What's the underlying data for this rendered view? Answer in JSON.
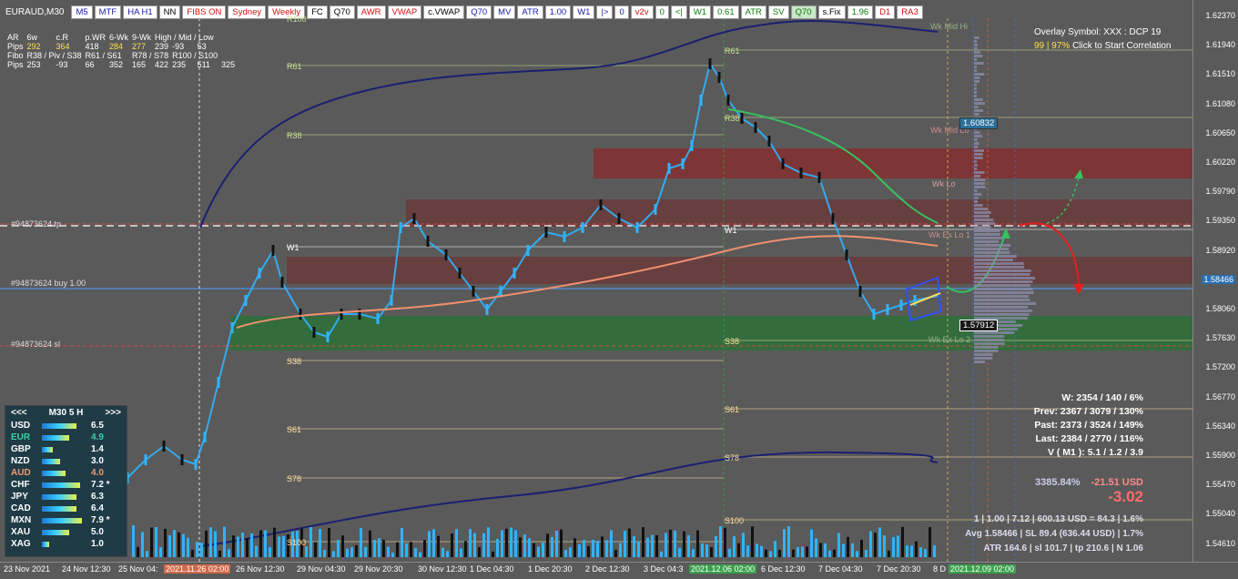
{
  "symbol": "EURAUD,M30",
  "toolbar": [
    {
      "label": "M5",
      "cls": ""
    },
    {
      "label": "MTF",
      "cls": ""
    },
    {
      "label": "HA H1",
      "cls": ""
    },
    {
      "label": "NN",
      "cls": "blk"
    },
    {
      "label": "FIBS ON",
      "cls": "red"
    },
    {
      "label": "Sydney",
      "cls": "red"
    },
    {
      "label": "Weekly",
      "cls": "red"
    },
    {
      "label": "FC",
      "cls": "blk"
    },
    {
      "label": "Q70",
      "cls": "blk"
    },
    {
      "label": "AWR",
      "cls": "red"
    },
    {
      "label": "VWAP",
      "cls": "red"
    },
    {
      "label": "c.VWAP",
      "cls": "blk"
    },
    {
      "label": "Q70",
      "cls": ""
    },
    {
      "label": "MV",
      "cls": ""
    },
    {
      "label": "ATR",
      "cls": ""
    },
    {
      "label": "1.00",
      "cls": ""
    },
    {
      "label": "W1",
      "cls": ""
    },
    {
      "label": "|>",
      "cls": ""
    },
    {
      "label": "0",
      "cls": ""
    },
    {
      "label": "v2v",
      "cls": "red"
    },
    {
      "label": "0",
      "cls": "grn"
    },
    {
      "label": "<|",
      "cls": "grn"
    },
    {
      "label": "W1",
      "cls": "grn"
    },
    {
      "label": "0.61",
      "cls": "grn"
    },
    {
      "label": "ATR",
      "cls": "grn"
    },
    {
      "label": "SV",
      "cls": "grn"
    },
    {
      "label": "Q70",
      "cls": "grn hl"
    },
    {
      "label": "s.Fix",
      "cls": "blk"
    },
    {
      "label": "1.96",
      "cls": "grn"
    },
    {
      "label": "D1",
      "cls": "red"
    },
    {
      "label": "RA3",
      "cls": "red"
    }
  ],
  "stats_panel": {
    "r1": [
      "AR",
      "6w",
      "c.R",
      "p.WR",
      "6-Wk",
      "9-Wk",
      "",
      "High / Mid / Low",
      ""
    ],
    "r2": [
      "Pips",
      "292",
      "364",
      "418",
      "284",
      "277",
      "239",
      "-93",
      "53"
    ],
    "r3": [
      "Fibo",
      "R38 / Piv / S38",
      "",
      "R61 / S61",
      "",
      "R78 / S78",
      "R100 / S100",
      ""
    ],
    "r4": [
      "Pips",
      "253",
      "-93",
      "66",
      "352",
      "165",
      "422",
      "235",
      "511",
      "325"
    ]
  },
  "overlay": {
    "line1": "Overlay Symbol: XXX : DCP 19",
    "pct": "99 | 97%",
    "line2": "Click to Start Correlation"
  },
  "y_ticks": [
    "1.62370",
    "1.61940",
    "1.61510",
    "1.61080",
    "1.60650",
    "1.60220",
    "1.59790",
    "1.59350",
    "1.58920",
    "1.58466",
    "1.58060",
    "1.57630",
    "1.57200",
    "1.56770",
    "1.56340",
    "1.55900",
    "1.55470",
    "1.55040",
    "1.54610"
  ],
  "x_ticks": [
    {
      "t": "23 Nov 2021",
      "c": ""
    },
    {
      "t": "24 Nov 12:30",
      "c": ""
    },
    {
      "t": "25 Nov 04:",
      "c": ""
    },
    {
      "t": "2021.11.26 02:00",
      "c": "hl"
    },
    {
      "t": "26 Nov 12:30",
      "c": ""
    },
    {
      "t": "29 Nov 04:30",
      "c": ""
    },
    {
      "t": "29 Nov 20:30",
      "c": ""
    },
    {
      "t": "30 Nov 12:30",
      "c": ""
    },
    {
      "t": "1 Dec 04:30",
      "c": ""
    },
    {
      "t": "1 Dec 20:30",
      "c": ""
    },
    {
      "t": "2 Dec 12:30",
      "c": ""
    },
    {
      "t": "3 Dec 04:3",
      "c": ""
    },
    {
      "t": "2021.12.06 02:00",
      "c": "hl2"
    },
    {
      "t": "6 Dec 12:30",
      "c": ""
    },
    {
      "t": "7 Dec 04:30",
      "c": ""
    },
    {
      "t": "7 Dec 20:30",
      "c": ""
    },
    {
      "t": "8 D",
      "c": ""
    },
    {
      "t": "2021.12.09 02:00",
      "c": "hl2"
    }
  ],
  "line_labels": {
    "tp": "#94873624 tp",
    "buy": "#94873624 buy 1.00",
    "sl": "#94873624 sl",
    "R61a": "R61",
    "R38a": "R38",
    "W1a": "W1",
    "S38a": "S38",
    "S61a": "S61",
    "S78a": "S78",
    "S100a": "S100",
    "R100a": "R100",
    "R61b": "R61",
    "R38b": "R38",
    "W1b": "W1",
    "S38b": "S38",
    "S61b": "S61",
    "S78b": "S78",
    "S100b": "S100",
    "wkmidhi": "Wk Mid Hi",
    "wkmidlo": "Wk Mid Lo",
    "wklo": "Wk Lo",
    "wkexlo1": "Wk Ex Lo 1",
    "wkexlo2": "Wk Ex Lo 2"
  },
  "price_boxes": {
    "a": "1.60832",
    "b": "1.57912",
    "cur": "1.58466"
  },
  "right_stats": {
    "w": "W: 2354 / 140 / 6%",
    "prev": "Prev: 2367 / 3079 / 130%",
    "past": "Past: 2373 / 3524 / 149%",
    "last": "Last: 2384 / 2770 / 116%",
    "v": "V ( M1 ): 5.1 / 1.2 / 3.9"
  },
  "pl": {
    "pct": "3385.84%",
    "usd": "-21.51 USD",
    "big": "-3.02"
  },
  "bottom_stats": {
    "l1": "1  |  1.00  |  7.12  |  600.13 USD = 84.3  |  1.6%",
    "l2": "Avg 1.58466  |  SL 89.4 (636.44 USD)  |  1.7%",
    "l3": "ATR 164.6  |  sl 101.7  |  tp 210.6  |  N 1.06"
  },
  "strength": {
    "prev": "<<<",
    "title": "M30  5  H",
    "next": ">>>",
    "rows": [
      {
        "cur": "USD",
        "val": "6.5",
        "color": "#ffffff",
        "w": 38
      },
      {
        "cur": "EUR",
        "val": "4.9",
        "color": "#3ad0a0",
        "w": 30
      },
      {
        "cur": "GBP",
        "val": "1.4",
        "color": "#ffffff",
        "w": 12
      },
      {
        "cur": "NZD",
        "val": "3.0",
        "color": "#ffffff",
        "w": 20
      },
      {
        "cur": "AUD",
        "val": "4.0",
        "color": "#f09a6a",
        "w": 26
      },
      {
        "cur": "CHF",
        "val": "7.2 *",
        "color": "#ffffff",
        "w": 42
      },
      {
        "cur": "JPY",
        "val": "6.3",
        "color": "#ffffff",
        "w": 38
      },
      {
        "cur": "CAD",
        "val": "6.4",
        "color": "#ffffff",
        "w": 38
      },
      {
        "cur": "MXN",
        "val": "7.9 *",
        "color": "#ffffff",
        "w": 44
      },
      {
        "cur": "XAU",
        "val": "5.0",
        "color": "#ffffff",
        "w": 30
      },
      {
        "cur": "XAG",
        "val": "1.0",
        "color": "#ffffff",
        "w": 8
      }
    ]
  },
  "colors": {
    "bull": "#2fb4ff",
    "bear": "#111111",
    "supply": "#8b2a2a",
    "demand": "#2f6e3a",
    "ma": "#1a2070"
  }
}
